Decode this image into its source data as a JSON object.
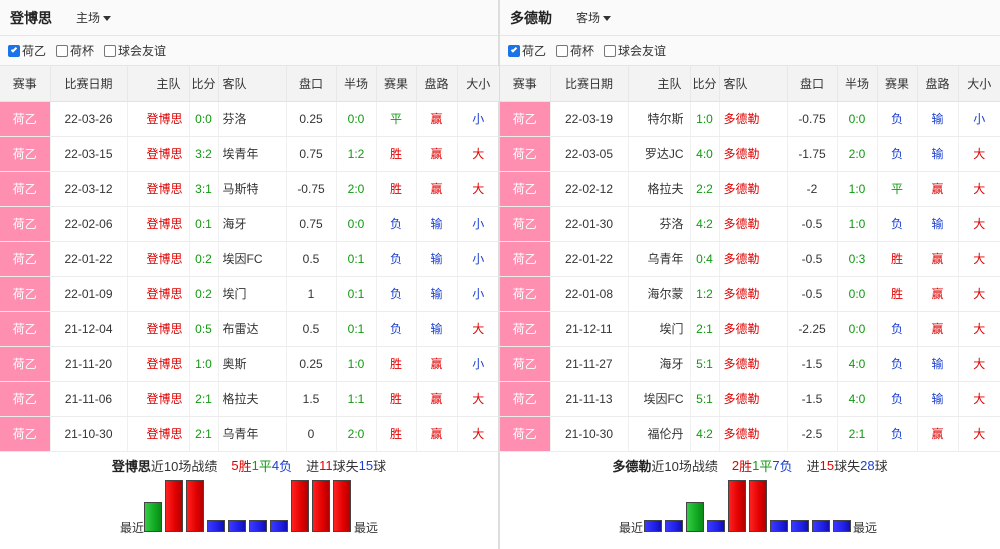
{
  "columns": [
    "赛事",
    "比赛日期",
    "主队",
    "比分",
    "客队",
    "盘口",
    "半场",
    "赛果",
    "盘路",
    "大小"
  ],
  "filters": [
    {
      "label": "荷乙",
      "checked": true
    },
    {
      "label": "荷杯",
      "checked": false
    },
    {
      "label": "球会友谊",
      "checked": false
    }
  ],
  "text": {
    "recent": "近10场战绩",
    "win": "胜",
    "draw": "平",
    "loss": "负",
    "scored": "进",
    "ball": "球",
    "conceded": "失",
    "latest": "最近",
    "oldest": "最远"
  },
  "colors": {
    "W": "#e00000",
    "D": "#119911",
    "L": "#1a3fcf",
    "league_bg": "#ff8fb0"
  },
  "left": {
    "team": "登博思",
    "venue": "主场",
    "rows": [
      {
        "league": "荷乙",
        "date": "22-03-26",
        "home": "登博思",
        "score": "0:0",
        "away": "芬洛",
        "handicap": "0.25",
        "half": "0:0",
        "result": "平",
        "cover": "赢",
        "ou": "小"
      },
      {
        "league": "荷乙",
        "date": "22-03-15",
        "home": "登博思",
        "score": "3:2",
        "away": "埃青年",
        "handicap": "0.75",
        "half": "1:2",
        "result": "胜",
        "cover": "赢",
        "ou": "大"
      },
      {
        "league": "荷乙",
        "date": "22-03-12",
        "home": "登博思",
        "score": "3:1",
        "away": "马斯特",
        "handicap": "-0.75",
        "half": "2:0",
        "result": "胜",
        "cover": "赢",
        "ou": "大"
      },
      {
        "league": "荷乙",
        "date": "22-02-06",
        "home": "登博思",
        "score": "0:1",
        "away": "海牙",
        "handicap": "0.75",
        "half": "0:0",
        "result": "负",
        "cover": "输",
        "ou": "小"
      },
      {
        "league": "荷乙",
        "date": "22-01-22",
        "home": "登博思",
        "score": "0:2",
        "away": "埃因FC",
        "handicap": "0.5",
        "half": "0:1",
        "result": "负",
        "cover": "输",
        "ou": "小"
      },
      {
        "league": "荷乙",
        "date": "22-01-09",
        "home": "登博思",
        "score": "0:2",
        "away": "埃门",
        "handicap": "1",
        "half": "0:1",
        "result": "负",
        "cover": "输",
        "ou": "小"
      },
      {
        "league": "荷乙",
        "date": "21-12-04",
        "home": "登博思",
        "score": "0:5",
        "away": "布雷达",
        "handicap": "0.5",
        "half": "0:1",
        "result": "负",
        "cover": "输",
        "ou": "大"
      },
      {
        "league": "荷乙",
        "date": "21-11-20",
        "home": "登博思",
        "score": "1:0",
        "away": "奥斯",
        "handicap": "0.25",
        "half": "1:0",
        "result": "胜",
        "cover": "赢",
        "ou": "小"
      },
      {
        "league": "荷乙",
        "date": "21-11-06",
        "home": "登博思",
        "score": "2:1",
        "away": "格拉夫",
        "handicap": "1.5",
        "half": "1:1",
        "result": "胜",
        "cover": "赢",
        "ou": "大"
      },
      {
        "league": "荷乙",
        "date": "21-10-30",
        "home": "登博思",
        "score": "2:1",
        "away": "乌青年",
        "handicap": "0",
        "half": "2:0",
        "result": "胜",
        "cover": "赢",
        "ou": "大"
      }
    ],
    "summary": {
      "wins": "5",
      "draws": "1",
      "losses": "4",
      "scored": "11",
      "conceded": "15"
    },
    "form": [
      "D",
      "W",
      "W",
      "L",
      "L",
      "L",
      "L",
      "W",
      "W",
      "W"
    ]
  },
  "right": {
    "team": "多德勒",
    "venue": "客场",
    "rows": [
      {
        "league": "荷乙",
        "date": "22-03-19",
        "home": "特尔斯",
        "score": "1:0",
        "away": "多德勒",
        "handicap": "-0.75",
        "half": "0:0",
        "result": "负",
        "cover": "输",
        "ou": "小"
      },
      {
        "league": "荷乙",
        "date": "22-03-05",
        "home": "罗达JC",
        "score": "4:0",
        "away": "多德勒",
        "handicap": "-1.75",
        "half": "2:0",
        "result": "负",
        "cover": "输",
        "ou": "大"
      },
      {
        "league": "荷乙",
        "date": "22-02-12",
        "home": "格拉夫",
        "score": "2:2",
        "away": "多德勒",
        "handicap": "-2",
        "half": "1:0",
        "result": "平",
        "cover": "赢",
        "ou": "大"
      },
      {
        "league": "荷乙",
        "date": "22-01-30",
        "home": "芬洛",
        "score": "4:2",
        "away": "多德勒",
        "handicap": "-0.5",
        "half": "1:0",
        "result": "负",
        "cover": "输",
        "ou": "大"
      },
      {
        "league": "荷乙",
        "date": "22-01-22",
        "home": "乌青年",
        "score": "0:4",
        "away": "多德勒",
        "handicap": "-0.5",
        "half": "0:3",
        "result": "胜",
        "cover": "赢",
        "ou": "大"
      },
      {
        "league": "荷乙",
        "date": "22-01-08",
        "home": "海尔蒙",
        "score": "1:2",
        "away": "多德勒",
        "handicap": "-0.5",
        "half": "0:0",
        "result": "胜",
        "cover": "赢",
        "ou": "大"
      },
      {
        "league": "荷乙",
        "date": "21-12-11",
        "home": "埃门",
        "score": "2:1",
        "away": "多德勒",
        "handicap": "-2.25",
        "half": "0:0",
        "result": "负",
        "cover": "赢",
        "ou": "大"
      },
      {
        "league": "荷乙",
        "date": "21-11-27",
        "home": "海牙",
        "score": "5:1",
        "away": "多德勒",
        "handicap": "-1.5",
        "half": "4:0",
        "result": "负",
        "cover": "输",
        "ou": "大"
      },
      {
        "league": "荷乙",
        "date": "21-11-13",
        "home": "埃因FC",
        "score": "5:1",
        "away": "多德勒",
        "handicap": "-1.5",
        "half": "4:0",
        "result": "负",
        "cover": "输",
        "ou": "大"
      },
      {
        "league": "荷乙",
        "date": "21-10-30",
        "home": "福伦丹",
        "score": "4:2",
        "away": "多德勒",
        "handicap": "-2.5",
        "half": "2:1",
        "result": "负",
        "cover": "赢",
        "ou": "大"
      }
    ],
    "summary": {
      "wins": "2",
      "draws": "1",
      "losses": "7",
      "scored": "15",
      "conceded": "28"
    },
    "form": [
      "L",
      "L",
      "D",
      "L",
      "W",
      "W",
      "L",
      "L",
      "L",
      "L"
    ]
  }
}
